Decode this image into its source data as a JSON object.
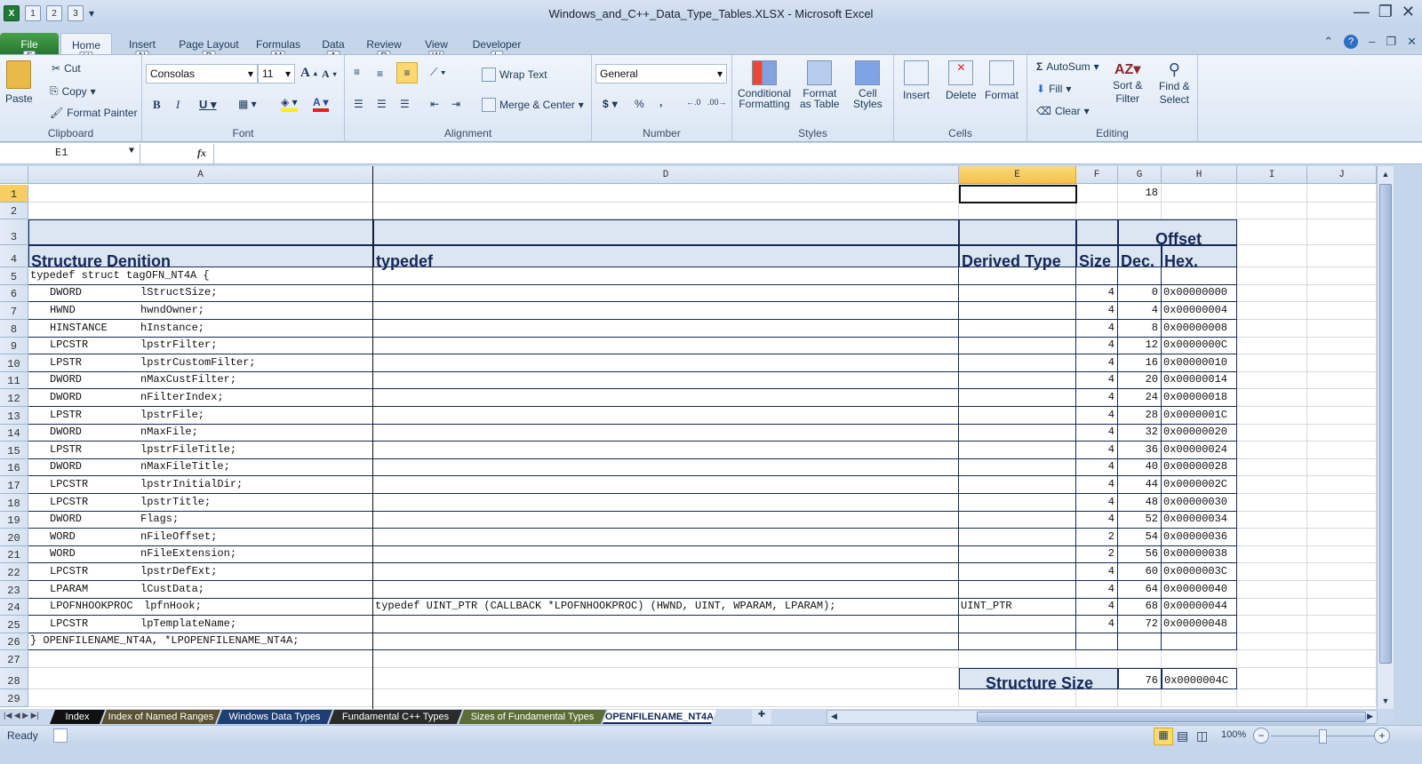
{
  "window": {
    "title": "Windows_and_C++_Data_Type_Tables.XLSX  -  Microsoft Excel"
  },
  "qat": {
    "save_key": "1",
    "undo_key": "2",
    "redo_key": "3"
  },
  "tabs": [
    {
      "label": "File",
      "key": "F"
    },
    {
      "label": "Home",
      "key": "H"
    },
    {
      "label": "Insert",
      "key": "N"
    },
    {
      "label": "Page Layout",
      "key": "P"
    },
    {
      "label": "Formulas",
      "key": "M"
    },
    {
      "label": "Data",
      "key": "A"
    },
    {
      "label": "Review",
      "key": "R"
    },
    {
      "label": "View",
      "key": "W"
    },
    {
      "label": "Developer",
      "key": "L"
    }
  ],
  "ribbon": {
    "clipboard": {
      "label": "Clipboard",
      "paste": "Paste",
      "cut": "Cut",
      "copy": "Copy",
      "format_painter": "Format Painter"
    },
    "font": {
      "label": "Font",
      "name": "Consolas",
      "size": "11"
    },
    "alignment": {
      "label": "Alignment",
      "wrap": "Wrap Text",
      "merge": "Merge & Center"
    },
    "number": {
      "label": "Number",
      "format": "General",
      "currency": "$",
      "percent": "%",
      "comma": ","
    },
    "styles": {
      "label": "Styles",
      "conditional": "Conditional",
      "conditional2": "Formatting",
      "format_table": "Format",
      "format_table2": "as Table",
      "cell_styles": "Cell",
      "cell_styles2": "Styles"
    },
    "cells": {
      "label": "Cells",
      "insert": "Insert",
      "delete": "Delete",
      "format": "Format"
    },
    "editing": {
      "label": "Editing",
      "autosum": "AutoSum",
      "fill": "Fill",
      "clear": "Clear",
      "sort": "Sort &",
      "sort2": "Filter",
      "find": "Find &",
      "find2": "Select"
    }
  },
  "formula_bar": {
    "name_box": "E1",
    "fx": "fx",
    "value": ""
  },
  "columns": [
    "A",
    "D",
    "E",
    "F",
    "G",
    "H",
    "I",
    "J"
  ],
  "sheet": {
    "g1": "18",
    "headers": {
      "offset": "Offset",
      "structure": "Structure Denition",
      "typedef": "typedef",
      "derived": "Derived Type",
      "size": "Size",
      "dec": "Dec.",
      "hex": "Hex."
    },
    "row5": "typedef struct tagOFN_NT4A {",
    "fields": [
      {
        "type": "DWORD",
        "name": "lStructSize;",
        "size": "4",
        "dec": "0",
        "hex": "0x00000000"
      },
      {
        "type": "HWND",
        "name": "hwndOwner;",
        "size": "4",
        "dec": "4",
        "hex": "0x00000004"
      },
      {
        "type": "HINSTANCE",
        "name": "hInstance;",
        "size": "4",
        "dec": "8",
        "hex": "0x00000008"
      },
      {
        "type": "LPCSTR",
        "name": "lpstrFilter;",
        "size": "4",
        "dec": "12",
        "hex": "0x0000000C"
      },
      {
        "type": "LPSTR",
        "name": "lpstrCustomFilter;",
        "size": "4",
        "dec": "16",
        "hex": "0x00000010"
      },
      {
        "type": "DWORD",
        "name": "nMaxCustFilter;",
        "size": "4",
        "dec": "20",
        "hex": "0x00000014"
      },
      {
        "type": "DWORD",
        "name": "nFilterIndex;",
        "size": "4",
        "dec": "24",
        "hex": "0x00000018"
      },
      {
        "type": "LPSTR",
        "name": "lpstrFile;",
        "size": "4",
        "dec": "28",
        "hex": "0x0000001C"
      },
      {
        "type": "DWORD",
        "name": "nMaxFile;",
        "size": "4",
        "dec": "32",
        "hex": "0x00000020"
      },
      {
        "type": "LPSTR",
        "name": "lpstrFileTitle;",
        "size": "4",
        "dec": "36",
        "hex": "0x00000024"
      },
      {
        "type": "DWORD",
        "name": "nMaxFileTitle;",
        "size": "4",
        "dec": "40",
        "hex": "0x00000028"
      },
      {
        "type": "LPCSTR",
        "name": "lpstrInitialDir;",
        "size": "4",
        "dec": "44",
        "hex": "0x0000002C"
      },
      {
        "type": "LPCSTR",
        "name": "lpstrTitle;",
        "size": "4",
        "dec": "48",
        "hex": "0x00000030"
      },
      {
        "type": "DWORD",
        "name": "Flags;",
        "size": "4",
        "dec": "52",
        "hex": "0x00000034"
      },
      {
        "type": "WORD",
        "name": "nFileOffset;",
        "size": "2",
        "dec": "54",
        "hex": "0x00000036"
      },
      {
        "type": "WORD",
        "name": "nFileExtension;",
        "size": "2",
        "dec": "56",
        "hex": "0x00000038"
      },
      {
        "type": "LPCSTR",
        "name": "lpstrDefExt;",
        "size": "4",
        "dec": "60",
        "hex": "0x0000003C"
      },
      {
        "type": "LPARAM",
        "name": "lCustData;",
        "size": "4",
        "dec": "64",
        "hex": "0x00000040"
      },
      {
        "type": "LPOFNHOOKPROC",
        "name": "lpfnHook;",
        "size": "4",
        "dec": "68",
        "hex": "0x00000044",
        "typedef": "typedef UINT_PTR (CALLBACK *LPOFNHOOKPROC) (HWND, UINT, WPARAM, LPARAM);",
        "derived": "UINT_PTR"
      },
      {
        "type": "LPCSTR",
        "name": "lpTemplateName;",
        "size": "4",
        "dec": "72",
        "hex": "0x00000048"
      }
    ],
    "row26": "} OPENFILENAME_NT4A, *LPOPENFILENAME_NT4A;",
    "structure_size_label": "Structure Size",
    "structure_size_dec": "76",
    "structure_size_hex": "0x0000004C"
  },
  "sheet_tabs": [
    {
      "label": "Index",
      "color": "#111111"
    },
    {
      "label": "Index of Named Ranges",
      "color": "#5a5233"
    },
    {
      "label": "Windows Data Types",
      "color": "#1f3f73"
    },
    {
      "label": "Fundamental C++ Types",
      "color": "#2b2b2b"
    },
    {
      "label": "Sizes of Fundamental Types",
      "color": "#5c6e33"
    },
    {
      "label": "OPENFILENAME_NT4A",
      "color": "#ffffff",
      "active": true
    }
  ],
  "status": {
    "ready": "Ready",
    "zoom": "100%",
    "zoom_fraction": 0.5
  }
}
